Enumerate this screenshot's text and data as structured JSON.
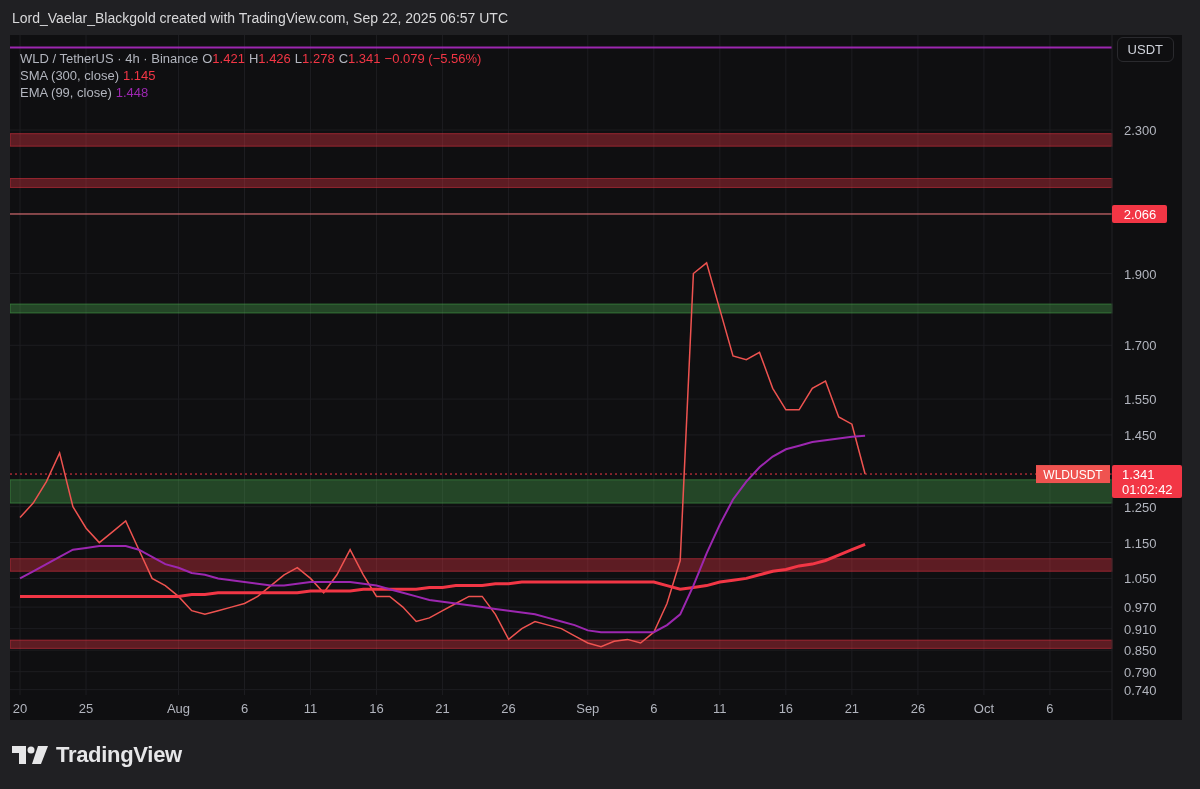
{
  "header": {
    "caption": "Lord_Vaelar_Blackgold created with TradingView.com, Sep 22, 2025 06:57 UTC"
  },
  "legend": {
    "symbol": "WLD / TetherUS · 4h · Binance",
    "ohlc": [
      {
        "key": "O",
        "value": "1.421"
      },
      {
        "key": "H",
        "value": "1.426"
      },
      {
        "key": "L",
        "value": "1.278"
      },
      {
        "key": "C",
        "value": "1.341"
      }
    ],
    "change": "−0.079 (−5.56%)",
    "indicator_values": [
      "1.145",
      "1.448"
    ]
  },
  "currency_button": "USDT",
  "countdown": "01:02:42",
  "chart_data": {
    "type": "line",
    "grid": true,
    "ylim": [
      0.725,
      2.565
    ],
    "categories": [
      "20",
      null,
      null,
      null,
      null,
      "25",
      null,
      null,
      null,
      null,
      null,
      null,
      "Aug",
      null,
      null,
      null,
      null,
      "6",
      null,
      null,
      null,
      null,
      "11",
      null,
      null,
      null,
      null,
      "16",
      null,
      null,
      null,
      null,
      "21",
      null,
      null,
      null,
      null,
      "26",
      null,
      null,
      null,
      null,
      null,
      "Sep",
      null,
      null,
      null,
      null,
      "6",
      null,
      null,
      null,
      null,
      "11",
      null,
      null,
      null,
      null,
      "16",
      null,
      null,
      null,
      null,
      "21",
      null,
      null,
      null,
      null,
      "26",
      null,
      null,
      null,
      null,
      "Oct",
      null,
      null,
      null,
      null,
      "6",
      null,
      null,
      null,
      null
    ],
    "series": [
      {
        "name": "WLDUSDT",
        "color": "#ef5350",
        "values": [
          1.22,
          1.26,
          1.32,
          1.4,
          1.25,
          1.19,
          1.15,
          1.18,
          1.21,
          1.13,
          1.05,
          1.03,
          1.0,
          0.96,
          0.95,
          0.96,
          0.97,
          0.98,
          1.0,
          1.03,
          1.06,
          1.08,
          1.05,
          1.01,
          1.06,
          1.13,
          1.06,
          1.0,
          1.0,
          0.97,
          0.93,
          0.94,
          0.96,
          0.98,
          1.0,
          1.0,
          0.95,
          0.88,
          0.91,
          0.93,
          0.92,
          0.91,
          0.89,
          0.87,
          0.86,
          0.875,
          0.88,
          0.87,
          0.9,
          0.98,
          1.1,
          1.9,
          1.93,
          1.8,
          1.67,
          1.66,
          1.68,
          1.58,
          1.52,
          1.52,
          1.58,
          1.6,
          1.5,
          1.48,
          1.341,
          null,
          null,
          null,
          null,
          null,
          null,
          null,
          null,
          null,
          null,
          null,
          null,
          null,
          null,
          null,
          null,
          null,
          null
        ]
      },
      {
        "name": "SMA (300, close)",
        "color": "#f23645",
        "values": [
          1.0,
          1.0,
          1.0,
          1.0,
          1.0,
          1.0,
          1.0,
          1.0,
          1.0,
          1.0,
          1.0,
          1.0,
          1.0,
          1.005,
          1.005,
          1.01,
          1.01,
          1.01,
          1.01,
          1.01,
          1.01,
          1.01,
          1.015,
          1.015,
          1.015,
          1.015,
          1.02,
          1.02,
          1.02,
          1.02,
          1.02,
          1.025,
          1.025,
          1.03,
          1.03,
          1.03,
          1.035,
          1.035,
          1.04,
          1.04,
          1.04,
          1.04,
          1.04,
          1.04,
          1.04,
          1.04,
          1.04,
          1.04,
          1.04,
          1.03,
          1.02,
          1.025,
          1.03,
          1.04,
          1.045,
          1.05,
          1.06,
          1.07,
          1.075,
          1.085,
          1.09,
          1.1,
          1.115,
          1.13,
          1.145,
          null,
          null,
          null,
          null,
          null,
          null,
          null,
          null,
          null,
          null,
          null,
          null,
          null,
          null,
          null,
          null,
          null,
          null
        ]
      },
      {
        "name": "EMA (99, close)",
        "color": "#9c27b0",
        "values": [
          1.05,
          1.07,
          1.09,
          1.11,
          1.13,
          1.135,
          1.14,
          1.14,
          1.14,
          1.13,
          1.11,
          1.09,
          1.08,
          1.065,
          1.06,
          1.05,
          1.045,
          1.04,
          1.035,
          1.03,
          1.03,
          1.035,
          1.04,
          1.04,
          1.04,
          1.04,
          1.035,
          1.03,
          1.02,
          1.01,
          1.0,
          0.99,
          0.985,
          0.98,
          0.975,
          0.97,
          0.965,
          0.96,
          0.955,
          0.95,
          0.94,
          0.93,
          0.92,
          0.905,
          0.9,
          0.9,
          0.9,
          0.9,
          0.9,
          0.92,
          0.95,
          1.03,
          1.12,
          1.2,
          1.27,
          1.32,
          1.36,
          1.39,
          1.41,
          1.42,
          1.43,
          1.435,
          1.44,
          1.445,
          1.448,
          null,
          null,
          null,
          null,
          null,
          null,
          null,
          null,
          null,
          null,
          null,
          null,
          null,
          null,
          null,
          null,
          null,
          null
        ]
      }
    ],
    "yticks": [
      {
        "value": 2.3,
        "label": "2.300"
      },
      {
        "value": 1.9,
        "label": "1.900"
      },
      {
        "value": 1.7,
        "label": "1.700"
      },
      {
        "value": 1.55,
        "label": "1.550"
      },
      {
        "value": 1.45,
        "label": "1.450"
      },
      {
        "value": 1.25,
        "label": "1.250"
      },
      {
        "value": 1.15,
        "label": "1.150"
      },
      {
        "value": 1.05,
        "label": "1.050"
      },
      {
        "value": 0.97,
        "label": "0.970"
      },
      {
        "value": 0.91,
        "label": "0.910"
      },
      {
        "value": 0.85,
        "label": "0.850"
      },
      {
        "value": 0.79,
        "label": "0.790"
      },
      {
        "value": 0.74,
        "label": "0.740"
      }
    ],
    "ref_lines": [
      {
        "axis": "y",
        "value": 2.53,
        "color": "#9c27b0"
      },
      {
        "axis": "y",
        "value": 2.066,
        "color": "#f77c80",
        "label": "2.066"
      },
      {
        "axis": "y",
        "value": 1.341,
        "color": "#f23645",
        "label": "1.341"
      }
    ],
    "bands": [
      {
        "axis": "y",
        "from": 2.255,
        "to": 2.29,
        "color": "#f23645"
      },
      {
        "axis": "y",
        "from": 2.14,
        "to": 2.165,
        "color": "#f23645"
      },
      {
        "axis": "y",
        "from": 1.79,
        "to": 1.815,
        "color": "#4caf50"
      },
      {
        "axis": "y",
        "from": 1.26,
        "to": 1.325,
        "color": "#4caf50"
      },
      {
        "axis": "y",
        "from": 1.07,
        "to": 1.105,
        "color": "#f23645"
      },
      {
        "axis": "y",
        "from": 0.855,
        "to": 0.878,
        "color": "#f23645"
      }
    ]
  },
  "footer": {
    "brand": "TradingView"
  }
}
